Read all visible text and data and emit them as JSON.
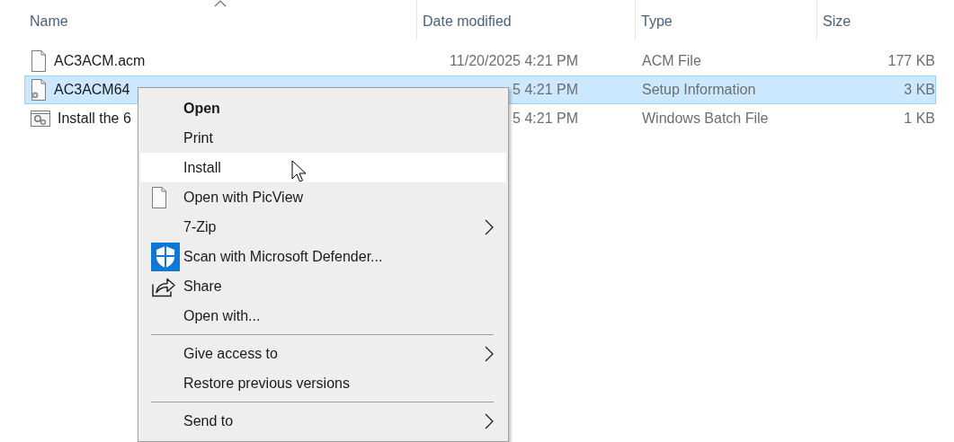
{
  "columns": [
    {
      "label": "Name",
      "sorted": true
    },
    {
      "label": "Date modified",
      "sorted": false
    },
    {
      "label": "Type",
      "sorted": false
    },
    {
      "label": "Size",
      "sorted": false
    }
  ],
  "files": [
    {
      "name": "AC3ACM.acm",
      "kind": "document",
      "date": "11/20/2025 4:21 PM",
      "type": "ACM File",
      "size": "177 KB",
      "selected": false
    },
    {
      "name": "AC3ACM64",
      "kind": "setup",
      "date": "5 4:21 PM",
      "type": "Setup Information",
      "size": "3 KB",
      "selected": true
    },
    {
      "name": "Install the 6",
      "kind": "batch",
      "date": "5 4:21 PM",
      "type": "Windows Batch File",
      "size": "1 KB",
      "selected": false
    }
  ],
  "context_menu": [
    {
      "kind": "item",
      "label": "Open",
      "bold": true,
      "hovered": false,
      "submenu": false
    },
    {
      "kind": "item",
      "label": "Print",
      "bold": false,
      "hovered": false,
      "submenu": false
    },
    {
      "kind": "item",
      "label": "Install",
      "bold": false,
      "hovered": true,
      "submenu": false
    },
    {
      "kind": "document",
      "label": "Open with PicView",
      "bold": false,
      "hovered": false,
      "submenu": false
    },
    {
      "kind": "item",
      "label": "7-Zip",
      "bold": false,
      "hovered": false,
      "submenu": true
    },
    {
      "kind": "defender",
      "label": "Scan with Microsoft Defender...",
      "bold": false,
      "hovered": false,
      "submenu": false
    },
    {
      "kind": "share",
      "label": "Share",
      "bold": false,
      "hovered": false,
      "submenu": false
    },
    {
      "kind": "item",
      "label": "Open with...",
      "bold": false,
      "hovered": false,
      "submenu": false
    },
    {
      "kind": "separator"
    },
    {
      "kind": "item",
      "label": "Give access to",
      "bold": false,
      "hovered": false,
      "submenu": true
    },
    {
      "kind": "item",
      "label": "Restore previous versions",
      "bold": false,
      "hovered": false,
      "submenu": false
    },
    {
      "kind": "separator"
    },
    {
      "kind": "item",
      "label": "Send to",
      "bold": false,
      "hovered": false,
      "submenu": true
    }
  ]
}
